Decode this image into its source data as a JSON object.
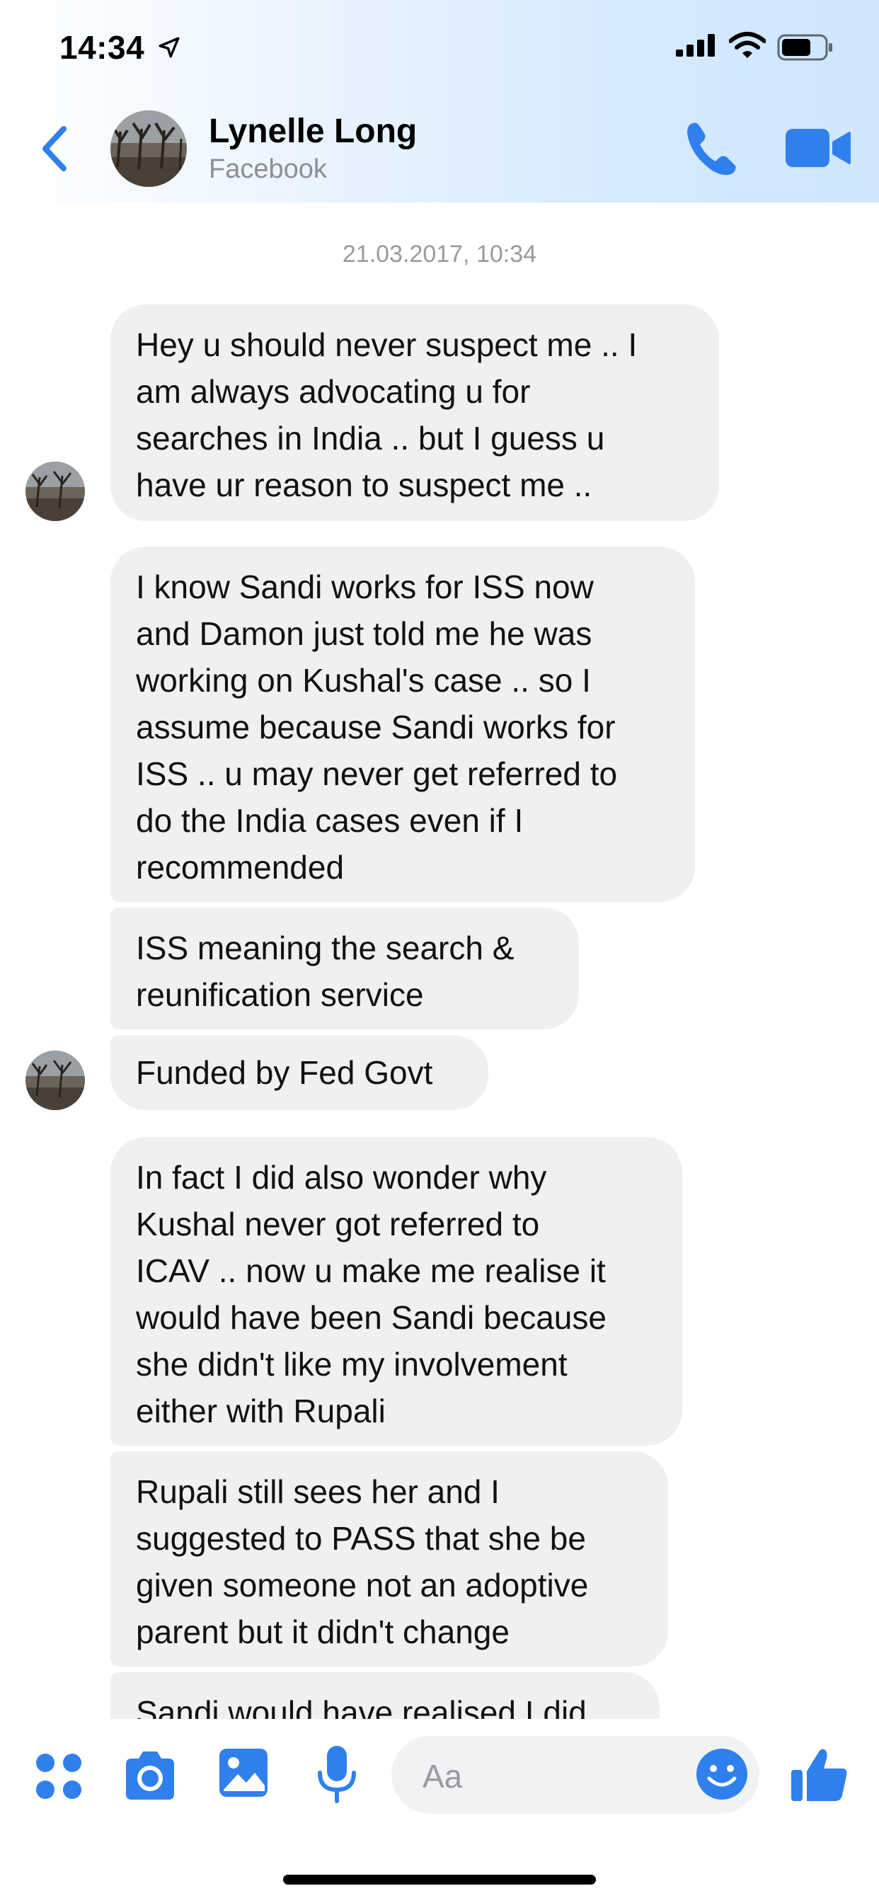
{
  "status_bar": {
    "time": "14:34"
  },
  "header": {
    "contact_name": "Lynelle Long",
    "contact_subtitle": "Facebook"
  },
  "conversation": {
    "timestamp": "21.03.2017, 10:34",
    "messages": [
      {
        "text": "Hey u should never suspect me .. I\nam always advocating u for\nsearches in India .. but I guess u\nhave ur reason to suspect me .."
      },
      {
        "text": "I know Sandi works for ISS now\nand Damon just told me he was\nworking on Kushal's case .. so I\nassume because Sandi works for\nISS .. u may never get referred to\ndo the India cases even if I\nrecommended"
      },
      {
        "text": "ISS meaning the search &\nreunification service"
      },
      {
        "text": "Funded by Fed Govt"
      },
      {
        "text": "In fact I did also wonder why\nKushal never got referred to\nICAV .. now u make me realise it\nwould have been Sandi because\nshe didn't like my involvement\neither with Rupali"
      },
      {
        "text": "Rupali still sees her and I\nsuggested to PASS that she be\ngiven someone not an adoptive\nparent but it didn't change"
      },
      {
        "text": "Sandi would have realised I did"
      }
    ]
  },
  "composer": {
    "placeholder": "Aa"
  },
  "colors": {
    "accent": "#2f80ed",
    "bubble_bg": "#f0f0f0"
  },
  "icons": [
    "location-arrow-icon",
    "signal-icon",
    "wifi-icon",
    "battery-icon",
    "back-chevron-icon",
    "phone-icon",
    "video-camera-icon",
    "apps-icon",
    "camera-icon",
    "photo-icon",
    "microphone-icon",
    "emoji-icon",
    "thumbs-up-icon"
  ]
}
